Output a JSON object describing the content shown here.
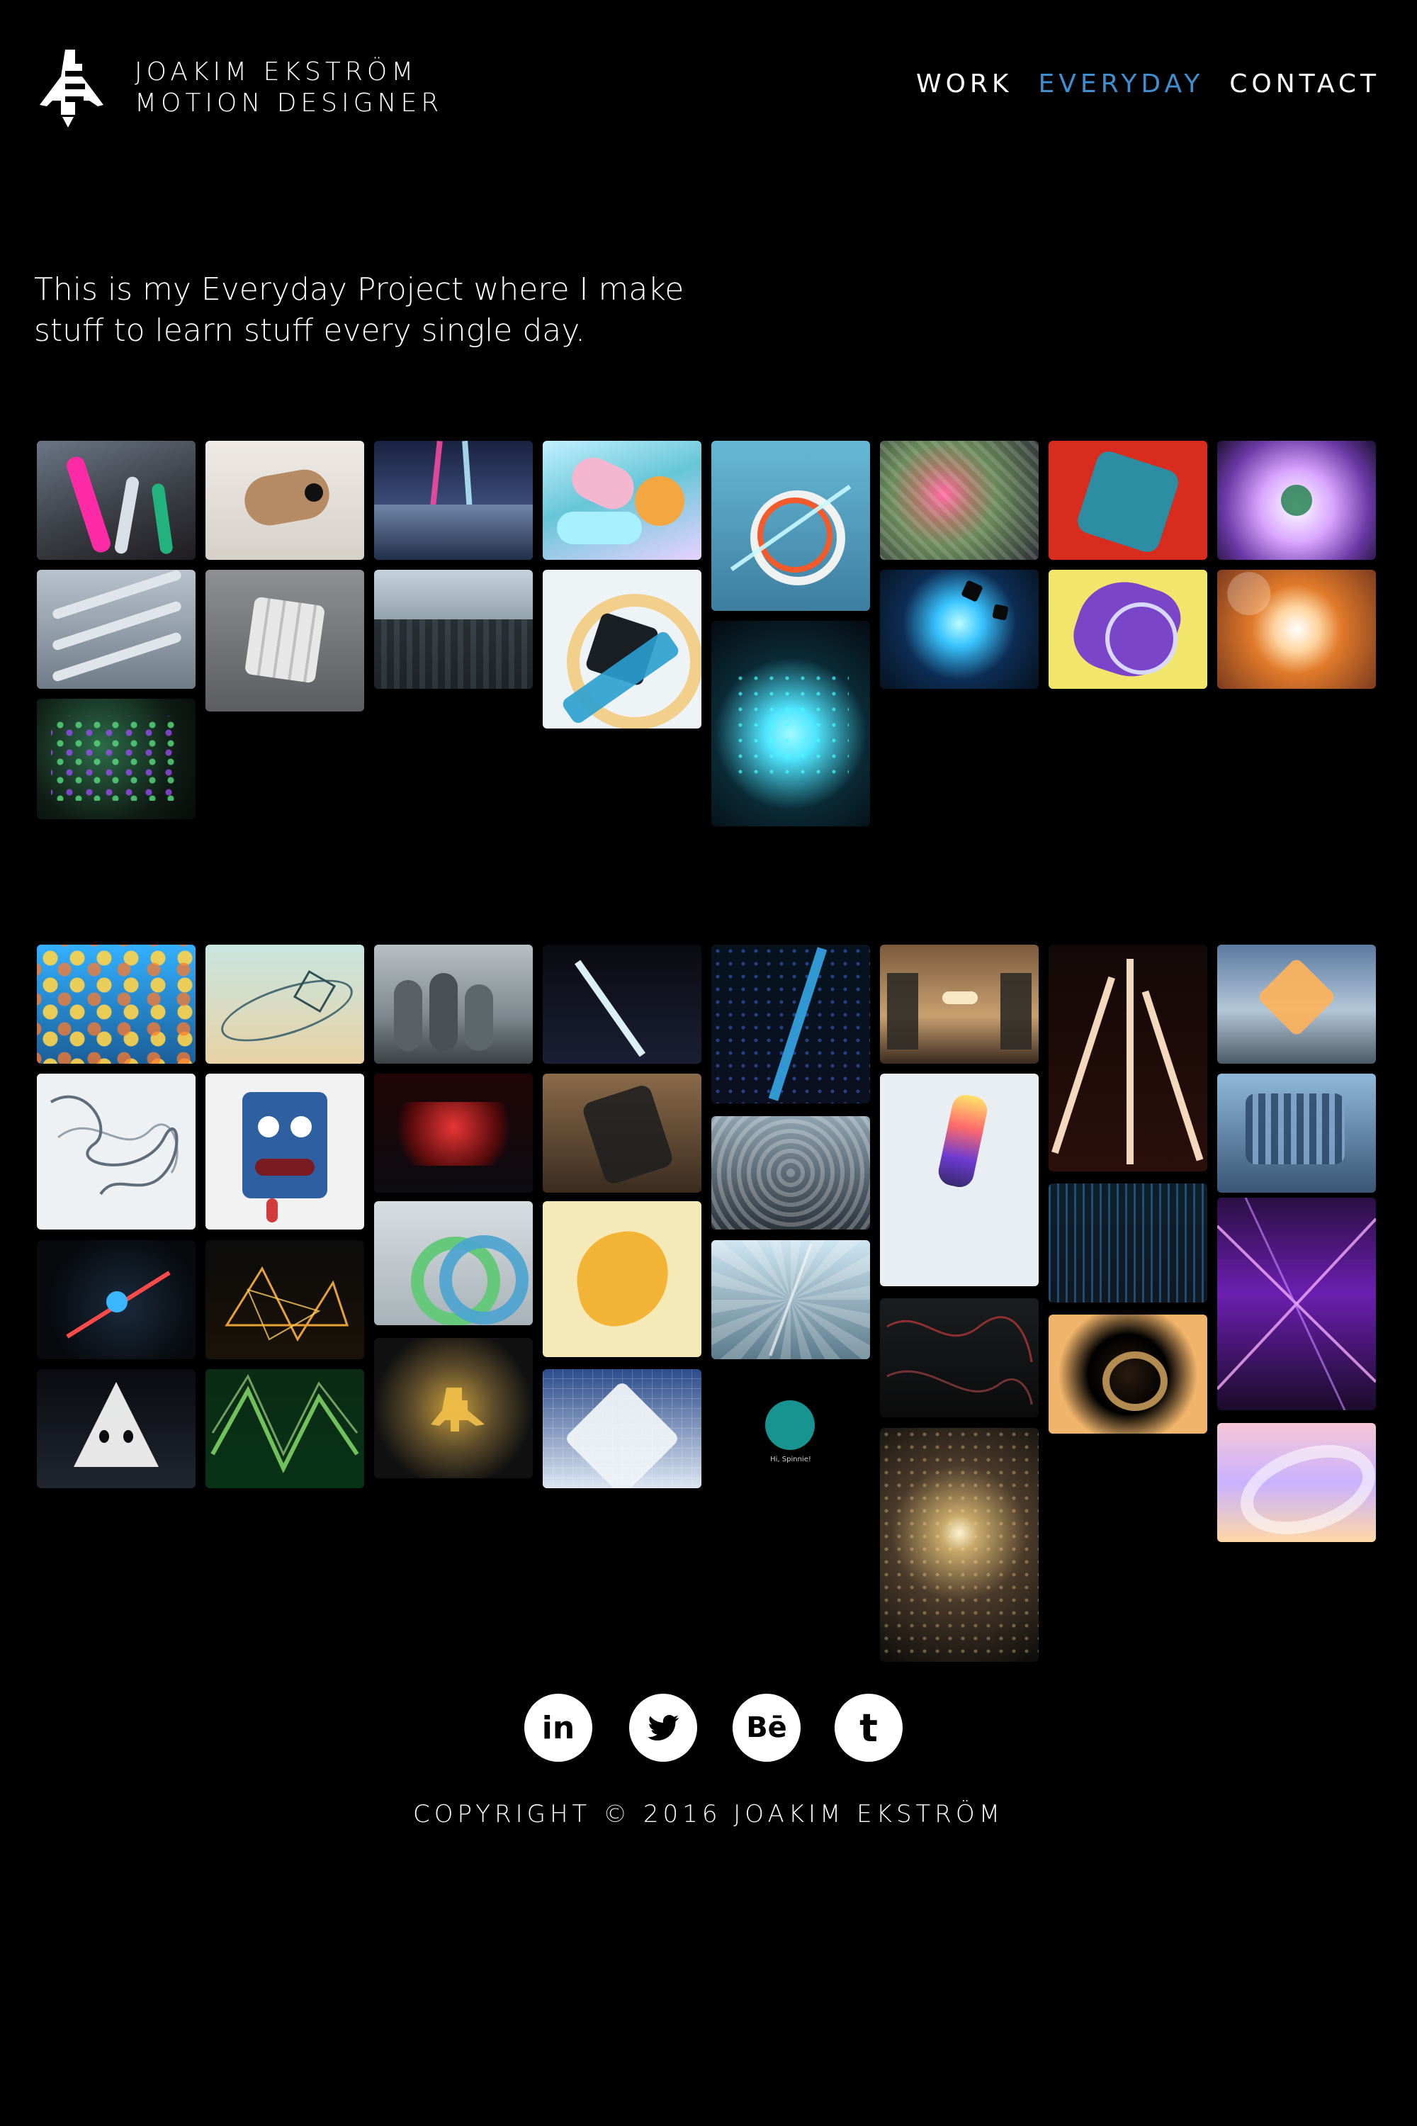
{
  "brand": {
    "line1": "JOAKIM EKSTRÖM",
    "line2": "MOTION DESIGNER"
  },
  "nav": {
    "work": "WORK",
    "everyday": "EVERYDAY",
    "contact": "CONTACT"
  },
  "intro": "This is my Everyday Project where I make stuff to learn stuff every single day.",
  "social": {
    "linkedin": "in",
    "twitter": "",
    "behance": "Bē",
    "tumblr": "t"
  },
  "footer": "COPYRIGHT © 2016 JOAKIM EKSTRÖM",
  "tile_thumb_caption": "Hi, Spinnie!"
}
